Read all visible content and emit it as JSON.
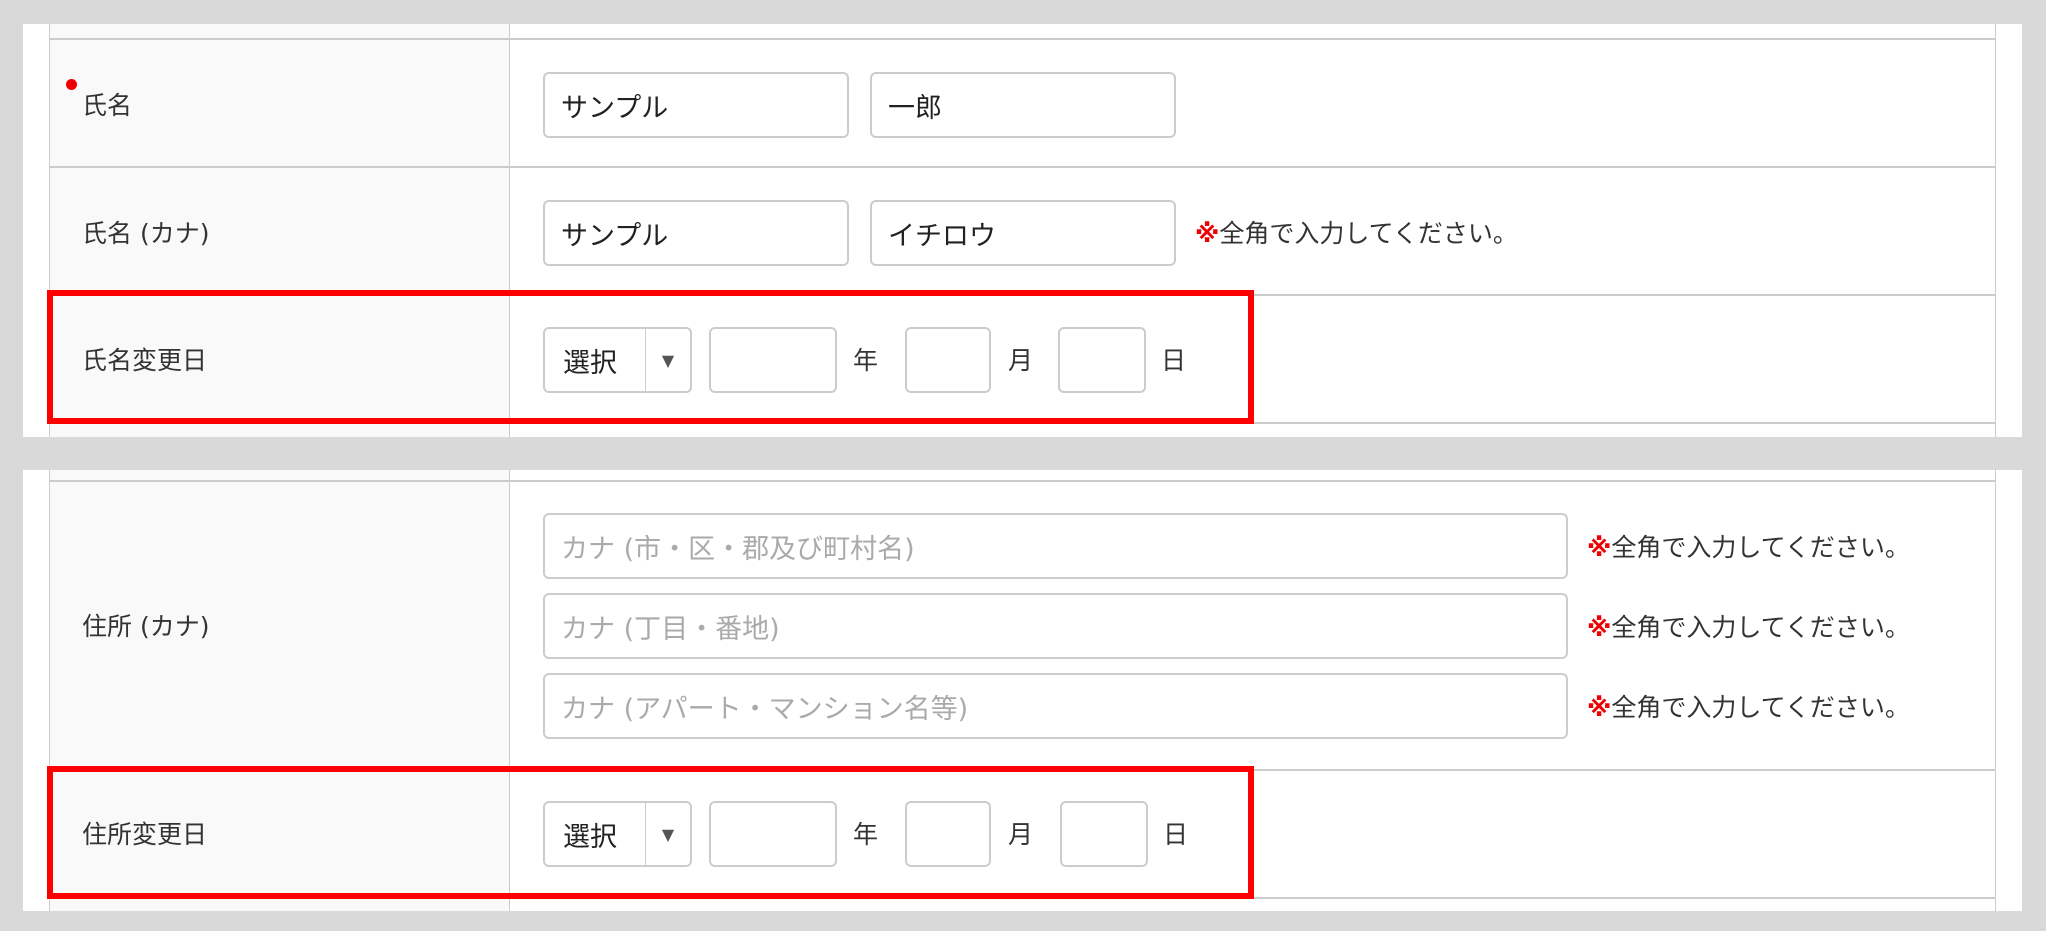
{
  "name_row": {
    "label": "氏名",
    "last": "サンプル",
    "first": "一郎"
  },
  "kana_row": {
    "label": "氏名 (カナ)",
    "last": "サンプル",
    "first": "イチロウ",
    "note_mark": "※",
    "note": "全角で入力してください。"
  },
  "name_change": {
    "label": "氏名変更日",
    "select": "選択",
    "year_unit": "年",
    "month_unit": "月",
    "day_unit": "日"
  },
  "address_kana": {
    "label": "住所 (カナ)",
    "placeholders": [
      "カナ (市・区・郡及び町村名)",
      "カナ (丁目・番地)",
      "カナ (アパート・マンション名等)"
    ],
    "note_mark": "※",
    "note": "全角で入力してください。"
  },
  "address_change": {
    "label": "住所変更日",
    "select": "選択",
    "year_unit": "年",
    "month_unit": "月",
    "day_unit": "日"
  },
  "colors": {
    "highlight": "#ff0000",
    "required": "#ee0000"
  }
}
